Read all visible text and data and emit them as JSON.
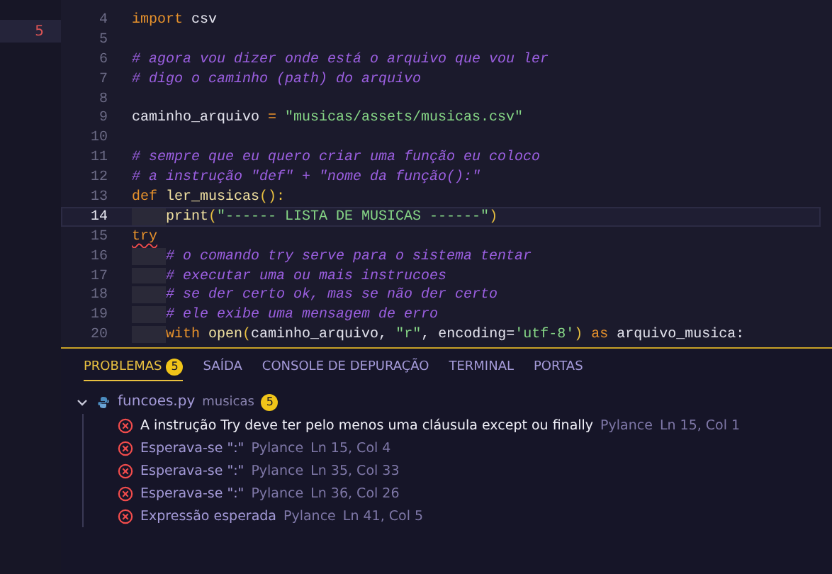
{
  "activity_bar": {
    "badge": "5"
  },
  "editor": {
    "lines": [
      {
        "number": "4",
        "current": false,
        "indented": false,
        "tokens": [
          {
            "text": "import",
            "kind": "keyword"
          },
          {
            "text": " csv",
            "kind": "name"
          }
        ]
      },
      {
        "number": "5",
        "current": false,
        "indented": false
      },
      {
        "number": "6",
        "current": false,
        "indented": false,
        "tokens": [
          {
            "text": "# agora vou dizer onde está o arquivo que vou ler",
            "kind": "comment"
          }
        ]
      },
      {
        "number": "7",
        "current": false,
        "indented": false,
        "tokens": [
          {
            "text": "# digo o caminho (path) do arquivo",
            "kind": "comment"
          }
        ]
      },
      {
        "number": "8",
        "current": false,
        "indented": false
      },
      {
        "number": "9",
        "current": false,
        "indented": false,
        "tokens": [
          {
            "text": "caminho_arquivo ",
            "kind": "name"
          },
          {
            "text": "=",
            "kind": "operator"
          },
          {
            "text": " \"musicas/assets/musicas.csv\"",
            "kind": "string"
          }
        ]
      },
      {
        "number": "10",
        "current": false,
        "indented": false
      },
      {
        "number": "11",
        "current": false,
        "indented": false,
        "tokens": [
          {
            "text": "# sempre que eu quero criar uma função eu coloco",
            "kind": "comment"
          }
        ]
      },
      {
        "number": "12",
        "current": false,
        "indented": false,
        "tokens": [
          {
            "text": "# a instrução \"def\" + \"nome da função():\"",
            "kind": "comment"
          }
        ]
      },
      {
        "number": "13",
        "current": false,
        "indented": false,
        "tokens": [
          {
            "text": "def",
            "kind": "keyword"
          },
          {
            "text": " ler_musicas",
            "kind": "function"
          },
          {
            "text": "():",
            "kind": "paren"
          }
        ]
      },
      {
        "number": "14",
        "current": true,
        "indented": true,
        "tokens": [
          {
            "text": "print",
            "kind": "function"
          },
          {
            "text": "(",
            "kind": "paren"
          },
          {
            "text": "\"------ LISTA DE MUSICAS ------\"",
            "kind": "string"
          },
          {
            "text": ")",
            "kind": "paren"
          }
        ]
      },
      {
        "number": "15",
        "current": false,
        "indented": false,
        "tokens": [
          {
            "text": "try",
            "kind": "keyword",
            "error": true
          }
        ]
      },
      {
        "number": "16",
        "current": false,
        "indented": true,
        "tokens": [
          {
            "text": "# o comando try serve para o sistema tentar",
            "kind": "comment"
          }
        ]
      },
      {
        "number": "17",
        "current": false,
        "indented": true,
        "tokens": [
          {
            "text": "# executar uma ou mais instrucoes",
            "kind": "comment"
          }
        ]
      },
      {
        "number": "18",
        "current": false,
        "indented": true,
        "tokens": [
          {
            "text": "# se der certo ok, mas se não der certo",
            "kind": "comment"
          }
        ]
      },
      {
        "number": "19",
        "current": false,
        "indented": true,
        "tokens": [
          {
            "text": "# ele exibe uma mensagem de erro",
            "kind": "comment"
          }
        ]
      },
      {
        "number": "20",
        "current": false,
        "indented": true,
        "tokens": [
          {
            "text": "with",
            "kind": "keyword"
          },
          {
            "text": " open",
            "kind": "function"
          },
          {
            "text": "(",
            "kind": "paren"
          },
          {
            "text": "caminho_arquivo, ",
            "kind": "name"
          },
          {
            "text": "\"r\"",
            "kind": "string"
          },
          {
            "text": ", encoding=",
            "kind": "name"
          },
          {
            "text": "'utf-8'",
            "kind": "string"
          },
          {
            "text": ")",
            "kind": "paren"
          },
          {
            "text": " as",
            "kind": "keyword"
          },
          {
            "text": " arquivo_musica:",
            "kind": "name"
          }
        ]
      }
    ]
  },
  "panel": {
    "tabs": [
      {
        "label": "PROBLEMAS",
        "selected": true,
        "badge": "5"
      },
      {
        "label": "SAÍDA",
        "selected": false
      },
      {
        "label": "CONSOLE DE DEPURAÇÃO",
        "selected": false
      },
      {
        "label": "TERMINAL",
        "selected": false
      },
      {
        "label": "PORTAS",
        "selected": false
      }
    ],
    "file": {
      "expanded": true,
      "name": "funcoes.py",
      "folder": "musicas",
      "count": "5"
    },
    "problems": [
      {
        "message": "A instrução Try deve ter pelo menos uma cláusula except ou finally",
        "source": "Pylance",
        "location": "Ln 15, Col 1",
        "selected": true
      },
      {
        "message": "Esperava-se \":\"",
        "source": "Pylance",
        "location": "Ln 15, Col 4",
        "selected": false
      },
      {
        "message": "Esperava-se \":\"",
        "source": "Pylance",
        "location": "Ln 35, Col 33",
        "selected": false
      },
      {
        "message": "Esperava-se \":\"",
        "source": "Pylance",
        "location": "Ln 36, Col 26",
        "selected": false
      },
      {
        "message": "Expressão esperada",
        "source": "Pylance",
        "location": "Ln 41, Col 5",
        "selected": false
      }
    ]
  }
}
